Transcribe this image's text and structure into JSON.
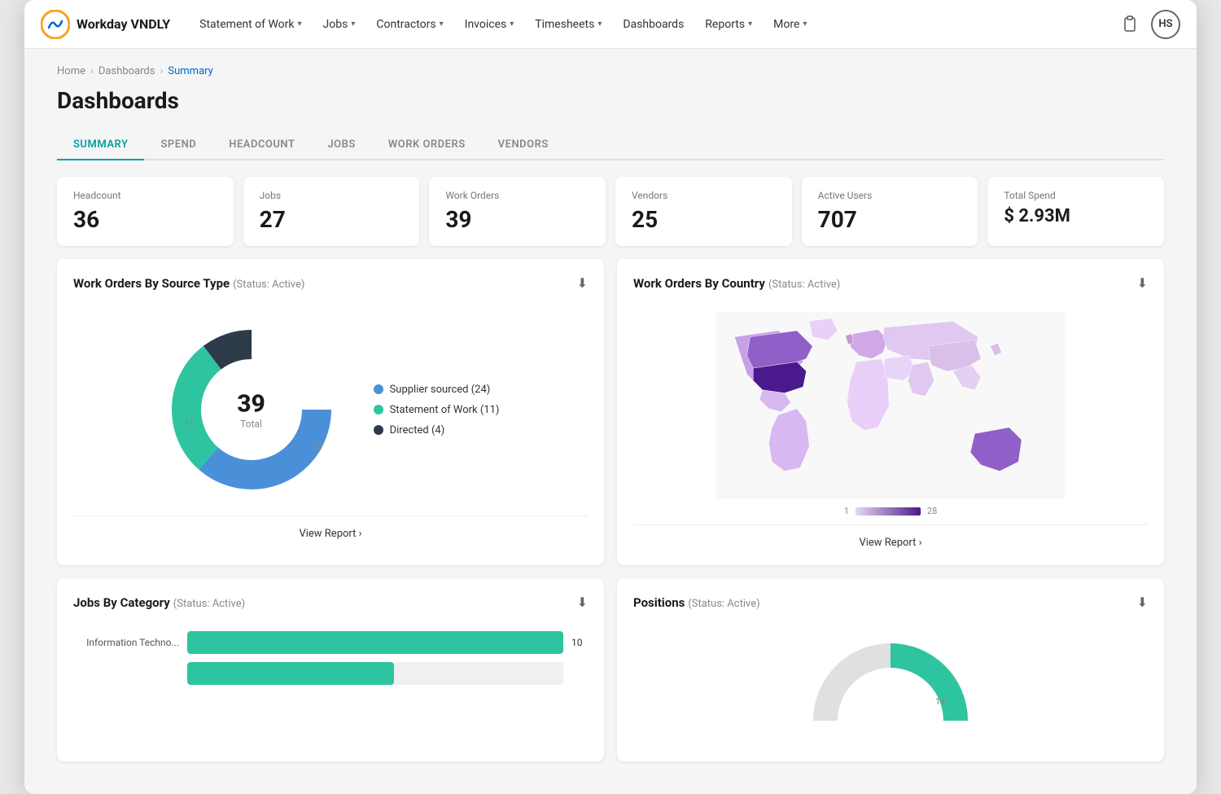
{
  "brand": {
    "name": "Workday VNDLY"
  },
  "nav": {
    "items": [
      {
        "label": "Statement of Work",
        "has_dropdown": true
      },
      {
        "label": "Jobs",
        "has_dropdown": true
      },
      {
        "label": "Contractors",
        "has_dropdown": true
      },
      {
        "label": "Invoices",
        "has_dropdown": true
      },
      {
        "label": "Timesheets",
        "has_dropdown": true
      },
      {
        "label": "Dashboards",
        "has_dropdown": false
      },
      {
        "label": "Reports",
        "has_dropdown": true
      },
      {
        "label": "More",
        "has_dropdown": true
      }
    ],
    "avatar_initials": "HS"
  },
  "breadcrumb": {
    "items": [
      {
        "label": "Home",
        "active": false
      },
      {
        "label": "Dashboards",
        "active": false
      },
      {
        "label": "Summary",
        "active": true
      }
    ]
  },
  "page": {
    "title": "Dashboards"
  },
  "tabs": [
    {
      "label": "SUMMARY",
      "active": true
    },
    {
      "label": "SPEND",
      "active": false
    },
    {
      "label": "HEADCOUNT",
      "active": false
    },
    {
      "label": "JOBS",
      "active": false
    },
    {
      "label": "WORK ORDERS",
      "active": false
    },
    {
      "label": "VENDORS",
      "active": false
    }
  ],
  "stats": [
    {
      "label": "Headcount",
      "value": "36"
    },
    {
      "label": "Jobs",
      "value": "27"
    },
    {
      "label": "Work Orders",
      "value": "39"
    },
    {
      "label": "Vendors",
      "value": "25"
    },
    {
      "label": "Active Users",
      "value": "707"
    },
    {
      "label": "Total Spend",
      "value": "$ 2.93M"
    }
  ],
  "work_orders_chart": {
    "title": "Work Orders By Source Type",
    "subtitle": "(Status: Active)",
    "total": "39",
    "total_label": "Total",
    "segments": [
      {
        "label": "Supplier sourced",
        "value": 24,
        "color": "#4a90d9",
        "percentage": 61.5
      },
      {
        "label": "Statement of Work",
        "value": 11,
        "color": "#2ec4a0",
        "percentage": 28.2
      },
      {
        "label": "Directed",
        "value": 4,
        "color": "#2d3a4a",
        "percentage": 10.3
      }
    ],
    "view_report": "View Report ›"
  },
  "work_orders_country": {
    "title": "Work Orders By Country",
    "subtitle": "(Status: Active)",
    "legend_min": "1",
    "legend_max": "28",
    "view_report": "View Report ›"
  },
  "jobs_category": {
    "title": "Jobs By Category",
    "subtitle": "(Status: Active)",
    "bars": [
      {
        "label": "Information Techno...",
        "value": 10,
        "percentage": 100
      }
    ]
  },
  "positions": {
    "title": "Positions",
    "subtitle": "(Status: Active)"
  }
}
